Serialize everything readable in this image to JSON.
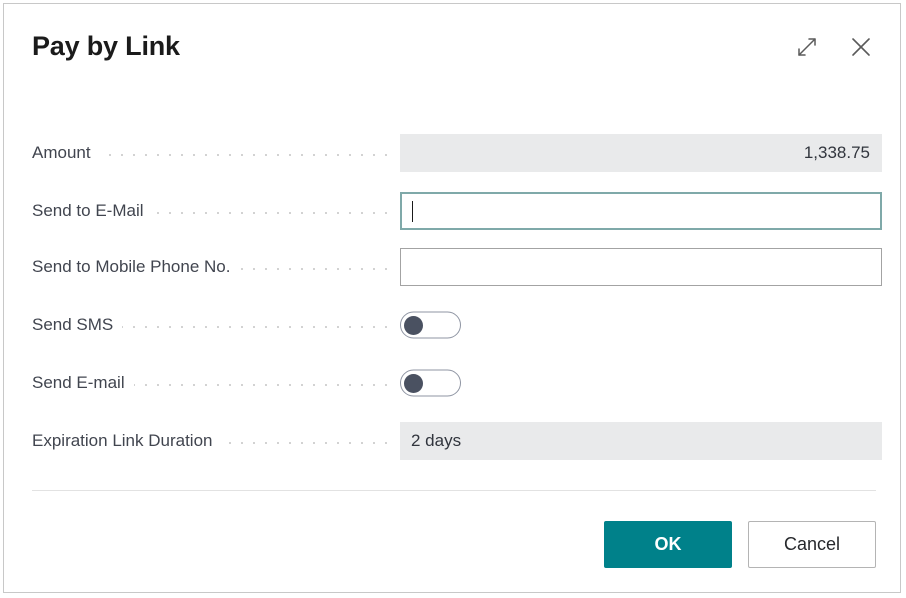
{
  "dialog": {
    "title": "Pay by Link",
    "expand_icon": "expand-diagonal-icon",
    "close_icon": "close-icon"
  },
  "colors": {
    "primary_teal": "#00818a",
    "focus_border": "#7fa9a9",
    "readonly_bg": "#e9eaeb",
    "label_text": "#41454f",
    "toggle_knob": "#4a5161"
  },
  "form": {
    "rows": [
      {
        "label": "Amount",
        "type": "readonly-number",
        "value": "1,338.75",
        "name": "amount"
      },
      {
        "label": "Send to E-Mail",
        "type": "text-focused",
        "value": "",
        "placeholder": "",
        "name": "send-to-email"
      },
      {
        "label": "Send to Mobile Phone No.",
        "type": "text",
        "value": "",
        "placeholder": "",
        "name": "send-to-mobile-phone-no"
      },
      {
        "label": "Send SMS",
        "type": "toggle",
        "value": "off",
        "name": "send-sms"
      },
      {
        "label": "Send E-mail",
        "type": "toggle",
        "value": "off",
        "name": "send-email"
      },
      {
        "label": "Expiration Link Duration",
        "type": "readonly-text",
        "value": "2 days",
        "name": "expiration-link-duration"
      }
    ]
  },
  "footer": {
    "ok_label": "OK",
    "cancel_label": "Cancel"
  }
}
